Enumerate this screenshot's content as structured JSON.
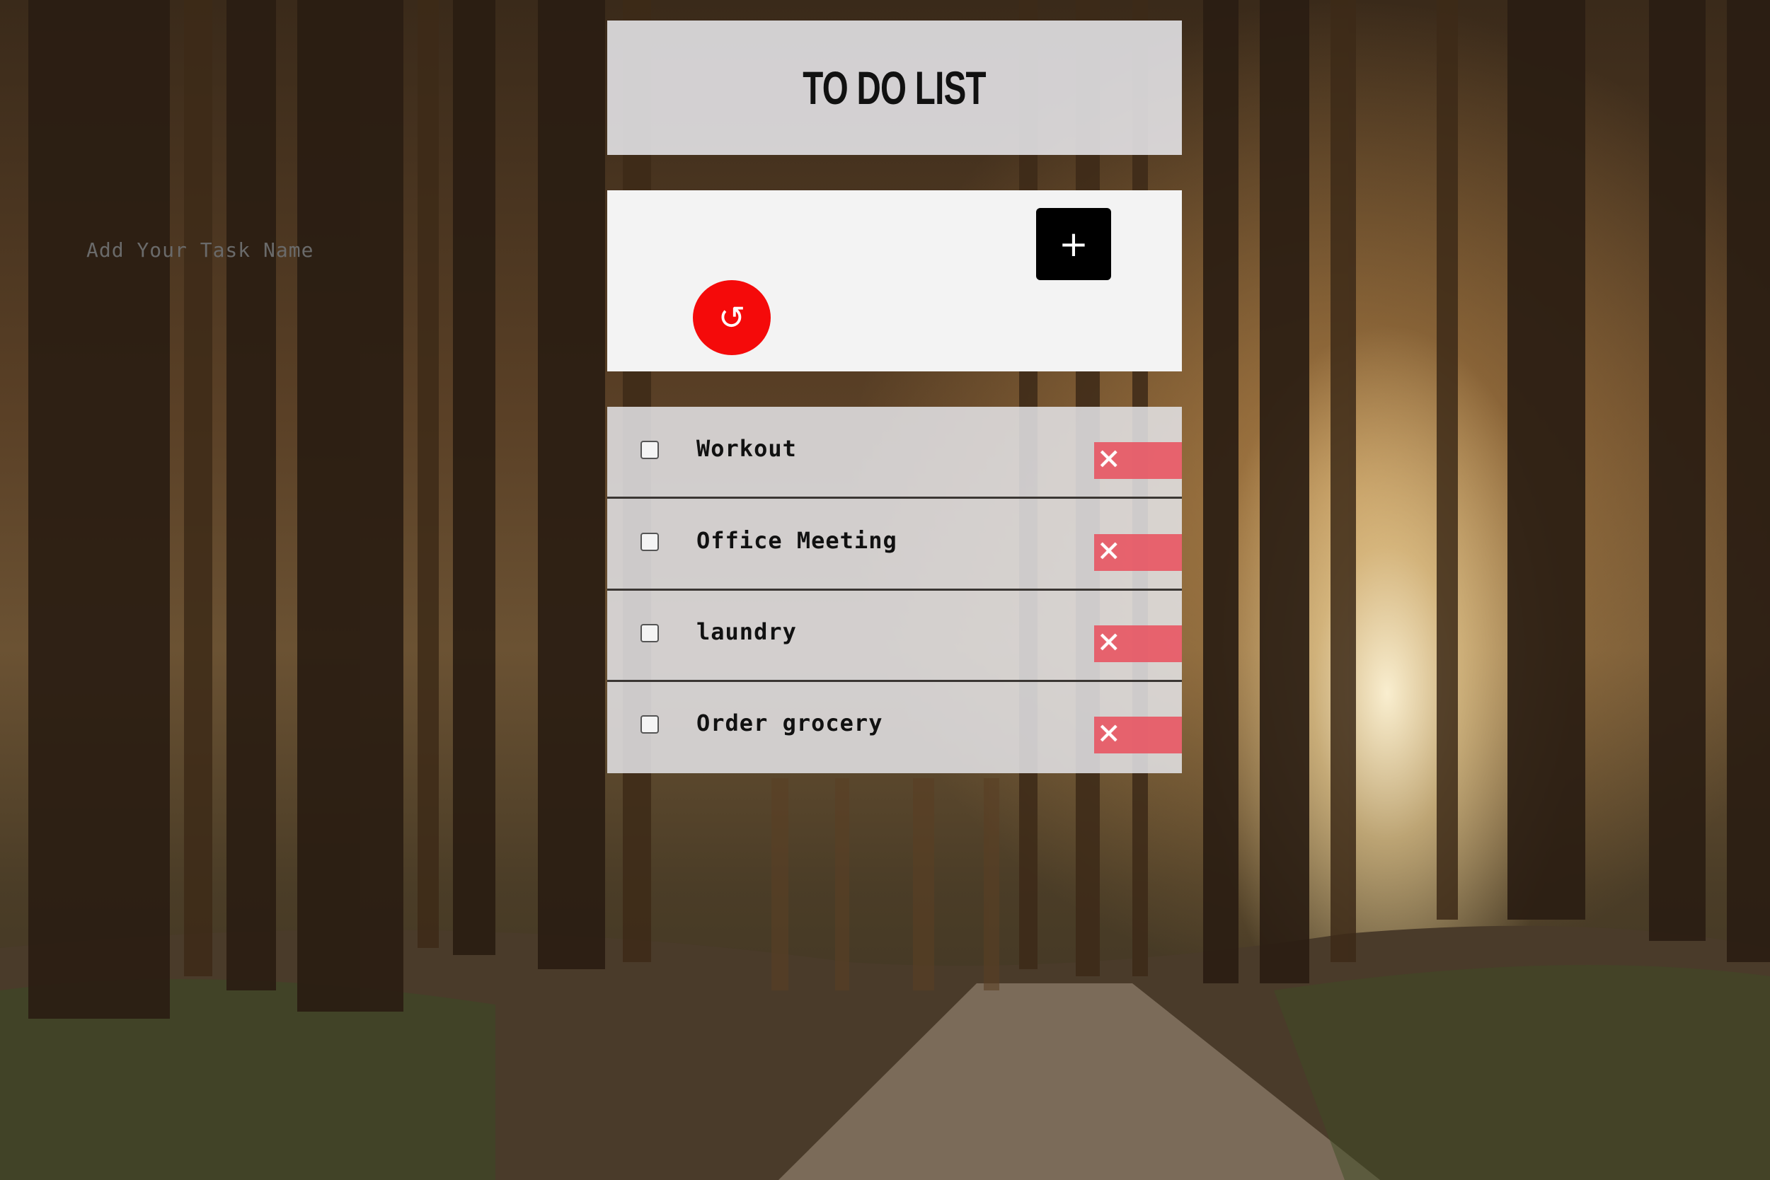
{
  "header": {
    "title": "TO DO LIST"
  },
  "input": {
    "placeholder": "Add Your Task Name",
    "value": "",
    "add_label": "+",
    "add_icon": "plus-icon",
    "reset_label": "↺",
    "reset_icon": "refresh-icon"
  },
  "tasks": [
    {
      "label": "Workout",
      "checked": false,
      "delete_label": "✕",
      "delete_icon": "close-icon"
    },
    {
      "label": "Office Meeting",
      "checked": false,
      "delete_label": "✕",
      "delete_icon": "close-icon"
    },
    {
      "label": "laundry",
      "checked": false,
      "delete_label": "✕",
      "delete_icon": "close-icon"
    },
    {
      "label": "Order grocery",
      "checked": false,
      "delete_label": "✕",
      "delete_icon": "close-icon"
    }
  ],
  "colors": {
    "add_button": "#000000",
    "reset_button": "#f50a0a",
    "delete_button": "#e85260",
    "divider": "#3a3633"
  }
}
